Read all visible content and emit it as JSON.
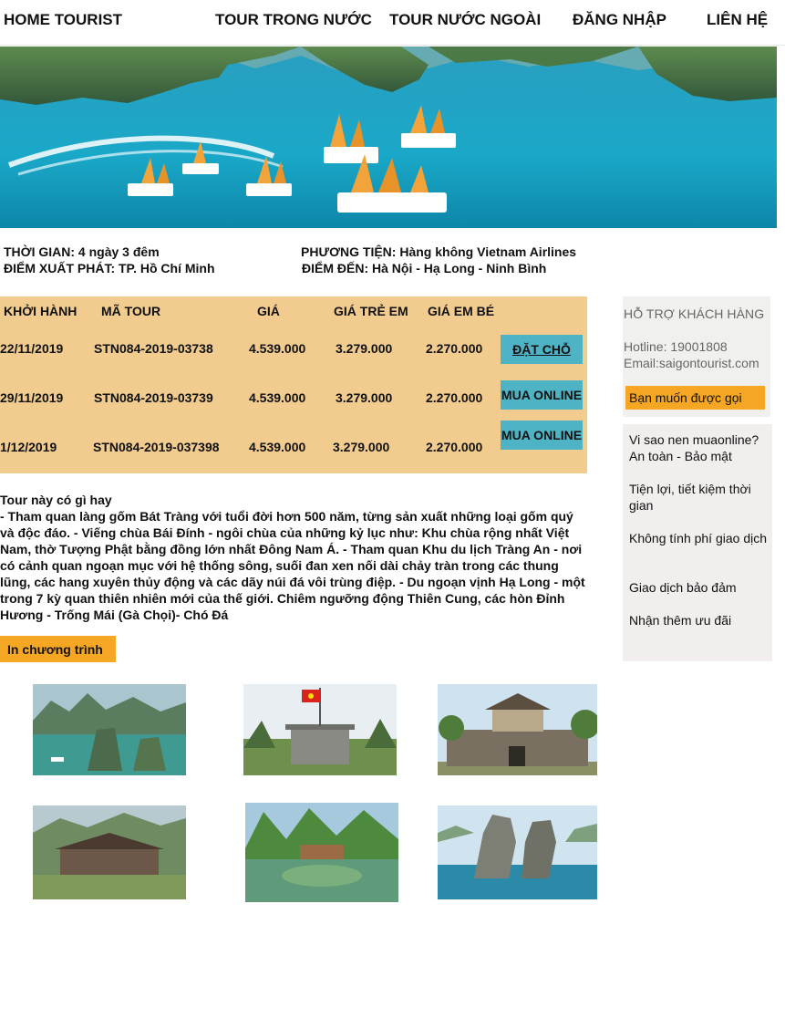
{
  "nav": {
    "brand": "HOME TOURIST",
    "domestic": "TOUR TRONG NƯỚC",
    "international": "TOUR NƯỚC NGOÀI",
    "login": "ĐĂNG NHẬP",
    "contact": "LIÊN HỆ"
  },
  "info": {
    "duration": "THỜI GIAN: 4 ngày 3 đêm",
    "transport": "PHƯƠNG TIỆN: Hàng không Vietnam Airlines",
    "departure": "ĐIỂM XUẤT PHÁT: TP. Hồ Chí Minh",
    "destination": "ĐIỂM ĐẾN: Hà Nội - Hạ Long - Ninh Bình"
  },
  "table": {
    "headers": [
      "KHỞI HÀNH",
      "MÃ TOUR",
      "GIÁ",
      "GIÁ TRẺ EM",
      "GIÁ EM BÉ"
    ],
    "rows": [
      {
        "date": "22/11/2019",
        "code": "STN084-2019-03738",
        "price": "4.539.000",
        "child": "3.279.000",
        "baby": "2.270.000",
        "action": "ĐẶT CHỖ"
      },
      {
        "date": "29/11/2019",
        "code": "STN084-2019-03739",
        "price": "4.539.000",
        "child": "3.279.000",
        "baby": "2.270.000",
        "action": "MUA ONLINE"
      },
      {
        "date": "1/12/2019",
        "code": "STN084-2019-037398",
        "price": "4.539.000",
        "child": "3.279.000",
        "baby": "2.270.000",
        "action": "MUA ONLINE"
      }
    ]
  },
  "description": {
    "title": "Tour này có gì hay",
    "body": "- Tham quan làng gốm Bát Tràng với tuổi đời hơn 500 năm, từng sản xuất những loại gốm quý và độc đáo. - Viếng chùa Bái Đính - ngôi chùa của những kỷ lục như: Khu chùa rộng nhất Việt Nam, thờ Tượng Phật bằng đồng lớn nhất Đông Nam Á. - Tham quan Khu du lịch Tràng An - nơi có cảnh quan ngoạn mục với hệ thống sông, suối đan xen nối dài chảy tràn trong các thung lũng, các hang xuyên thủy động và các dãy núi đá vôi trùng điệp. - Du ngoạn vịnh Hạ Long - một trong 7 kỳ quan thiên nhiên mới của thế giới. Chiêm ngưỡng động Thiên Cung, các hòn Đỉnh Hương - Trống Mái (Gà Chọi)- Chó Đá",
    "print_label": "In chương trình"
  },
  "support": {
    "title": "HỖ TRỢ KHÁCH HÀNG",
    "hotline": "Hotline: 19001808",
    "email": "Email:saigontourist.com",
    "call_button": "Bạn muốn được gọi"
  },
  "why": {
    "items": [
      "Vi sao nen muaonline? An toàn - Bảo mật",
      "Tiện lợi, tiết kiệm thời gian",
      "Không tính phí giao dịch",
      "Giao dịch bảo đảm",
      "Nhận thêm ưu đãi"
    ]
  },
  "colors": {
    "table_bg": "#f1cc8e",
    "button_teal": "#4fb3c6",
    "accent_orange": "#f5a623",
    "sidebar_bg": "#f0f0ee"
  }
}
